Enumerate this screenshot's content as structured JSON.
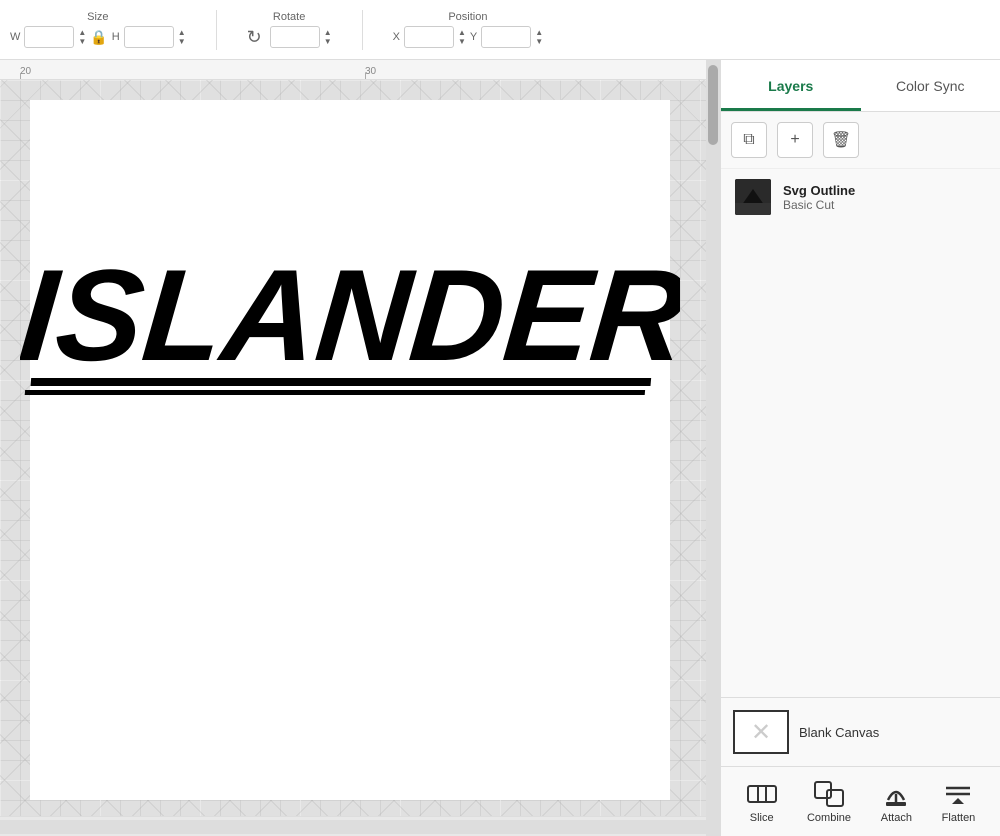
{
  "toolbar": {
    "size_label": "Size",
    "width_label": "W",
    "height_label": "H",
    "rotate_label": "Rotate",
    "position_label": "Position",
    "x_label": "X",
    "y_label": "Y",
    "width_value": "",
    "height_value": "",
    "rotate_value": "",
    "x_value": "",
    "y_value": ""
  },
  "tabs": {
    "layers_label": "Layers",
    "color_sync_label": "Color Sync",
    "active": "layers"
  },
  "panel_tools": {
    "copy_icon": "⧉",
    "add_icon": "+",
    "delete_icon": "🗑"
  },
  "layers": [
    {
      "name": "Svg Outline",
      "type": "Basic Cut",
      "thumb_color": "#222"
    }
  ],
  "canvas": {
    "ruler_marks": [
      "20",
      "30"
    ],
    "ruler_positions": [
      20,
      367
    ]
  },
  "blank_canvas": {
    "label": "Blank Canvas"
  },
  "bottom_actions": [
    {
      "label": "Slice",
      "icon": "slice"
    },
    {
      "label": "Combine",
      "icon": "combine"
    },
    {
      "label": "Attach",
      "icon": "attach"
    },
    {
      "label": "Flatten",
      "icon": "flatten"
    }
  ],
  "accent_color": "#1a7a4a"
}
